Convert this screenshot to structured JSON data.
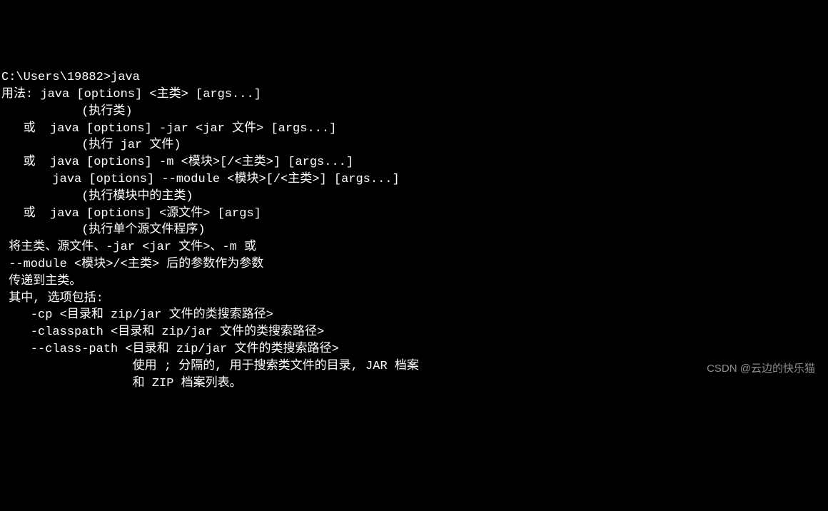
{
  "terminal": {
    "lines": [
      "C:\\Users\\19882>java",
      "用法: java [options] <主类> [args...]",
      "           (执行类)",
      "   或  java [options] -jar <jar 文件> [args...]",
      "           (执行 jar 文件)",
      "   或  java [options] -m <模块>[/<主类>] [args...]",
      "       java [options] --module <模块>[/<主类>] [args...]",
      "           (执行模块中的主类)",
      "   或  java [options] <源文件> [args]",
      "           (执行单个源文件程序)",
      "",
      " 将主类、源文件、-jar <jar 文件>、-m 或",
      " --module <模块>/<主类> 后的参数作为参数",
      " 传递到主类。",
      "",
      " 其中, 选项包括:",
      "",
      "    -cp <目录和 zip/jar 文件的类搜索路径>",
      "    -classpath <目录和 zip/jar 文件的类搜索路径>",
      "    --class-path <目录和 zip/jar 文件的类搜索路径>",
      "                  使用 ; 分隔的, 用于搜索类文件的目录, JAR 档案",
      "                  和 ZIP 档案列表。"
    ]
  },
  "watermark": {
    "text": "CSDN @云边的快乐猫"
  }
}
